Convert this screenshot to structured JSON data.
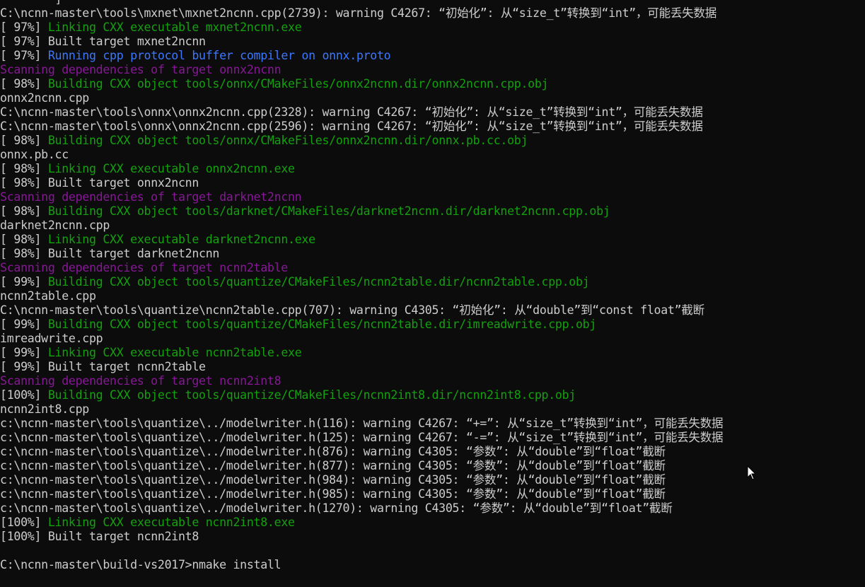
{
  "colors": {
    "background": "#0c0c0c",
    "default": "#cccccc",
    "green": "#13a10e",
    "blue": "#3b78ff",
    "magenta": "#881798"
  },
  "lines": [
    {
      "prefix": "",
      "text": "        ]",
      "color": "default"
    },
    {
      "prefix": "",
      "text": "C:\\ncnn-master\\tools\\mxnet\\mxnet2ncnn.cpp(2739): warning C4267: “初始化”: 从“size_t”转换到“int”，可能丢失数据",
      "color": "default"
    },
    {
      "prefix": "[ 97%] ",
      "text": "Linking CXX executable mxnet2ncnn.exe",
      "color": "green"
    },
    {
      "prefix": "[ 97%] ",
      "text": "Built target mxnet2ncnn",
      "color": "default"
    },
    {
      "prefix": "[ 97%] ",
      "text": "Running cpp protocol buffer compiler on onnx.proto",
      "color": "blue"
    },
    {
      "prefix": "",
      "text": "Scanning dependencies of target onnx2ncnn",
      "color": "magenta"
    },
    {
      "prefix": "[ 98%] ",
      "text": "Building CXX object tools/onnx/CMakeFiles/onnx2ncnn.dir/onnx2ncnn.cpp.obj",
      "color": "green"
    },
    {
      "prefix": "",
      "text": "onnx2ncnn.cpp",
      "color": "default"
    },
    {
      "prefix": "",
      "text": "C:\\ncnn-master\\tools\\onnx\\onnx2ncnn.cpp(2328): warning C4267: “初始化”: 从“size_t”转换到“int”，可能丢失数据",
      "color": "default"
    },
    {
      "prefix": "",
      "text": "C:\\ncnn-master\\tools\\onnx\\onnx2ncnn.cpp(2596): warning C4267: “初始化”: 从“size_t”转换到“int”，可能丢失数据",
      "color": "default"
    },
    {
      "prefix": "[ 98%] ",
      "text": "Building CXX object tools/onnx/CMakeFiles/onnx2ncnn.dir/onnx.pb.cc.obj",
      "color": "green"
    },
    {
      "prefix": "",
      "text": "onnx.pb.cc",
      "color": "default"
    },
    {
      "prefix": "[ 98%] ",
      "text": "Linking CXX executable onnx2ncnn.exe",
      "color": "green"
    },
    {
      "prefix": "[ 98%] ",
      "text": "Built target onnx2ncnn",
      "color": "default"
    },
    {
      "prefix": "",
      "text": "Scanning dependencies of target darknet2ncnn",
      "color": "magenta"
    },
    {
      "prefix": "[ 98%] ",
      "text": "Building CXX object tools/darknet/CMakeFiles/darknet2ncnn.dir/darknet2ncnn.cpp.obj",
      "color": "green"
    },
    {
      "prefix": "",
      "text": "darknet2ncnn.cpp",
      "color": "default"
    },
    {
      "prefix": "[ 98%] ",
      "text": "Linking CXX executable darknet2ncnn.exe",
      "color": "green"
    },
    {
      "prefix": "[ 98%] ",
      "text": "Built target darknet2ncnn",
      "color": "default"
    },
    {
      "prefix": "",
      "text": "Scanning dependencies of target ncnn2table",
      "color": "magenta"
    },
    {
      "prefix": "[ 99%] ",
      "text": "Building CXX object tools/quantize/CMakeFiles/ncnn2table.dir/ncnn2table.cpp.obj",
      "color": "green"
    },
    {
      "prefix": "",
      "text": "ncnn2table.cpp",
      "color": "default"
    },
    {
      "prefix": "",
      "text": "C:\\ncnn-master\\tools\\quantize\\ncnn2table.cpp(707): warning C4305: “初始化”: 从“double”到“const float”截断",
      "color": "default"
    },
    {
      "prefix": "[ 99%] ",
      "text": "Building CXX object tools/quantize/CMakeFiles/ncnn2table.dir/imreadwrite.cpp.obj",
      "color": "green"
    },
    {
      "prefix": "",
      "text": "imreadwrite.cpp",
      "color": "default"
    },
    {
      "prefix": "[ 99%] ",
      "text": "Linking CXX executable ncnn2table.exe",
      "color": "green"
    },
    {
      "prefix": "[ 99%] ",
      "text": "Built target ncnn2table",
      "color": "default"
    },
    {
      "prefix": "",
      "text": "Scanning dependencies of target ncnn2int8",
      "color": "magenta"
    },
    {
      "prefix": "[100%] ",
      "text": "Building CXX object tools/quantize/CMakeFiles/ncnn2int8.dir/ncnn2int8.cpp.obj",
      "color": "green"
    },
    {
      "prefix": "",
      "text": "ncnn2int8.cpp",
      "color": "default"
    },
    {
      "prefix": "",
      "text": "c:\\ncnn-master\\tools\\quantize\\../modelwriter.h(116): warning C4267: “+=”: 从“size_t”转换到“int”，可能丢失数据",
      "color": "default"
    },
    {
      "prefix": "",
      "text": "c:\\ncnn-master\\tools\\quantize\\../modelwriter.h(125): warning C4267: “-=”: 从“size_t”转换到“int”，可能丢失数据",
      "color": "default"
    },
    {
      "prefix": "",
      "text": "c:\\ncnn-master\\tools\\quantize\\../modelwriter.h(876): warning C4305: “参数”: 从“double”到“float”截断",
      "color": "default"
    },
    {
      "prefix": "",
      "text": "c:\\ncnn-master\\tools\\quantize\\../modelwriter.h(877): warning C4305: “参数”: 从“double”到“float”截断",
      "color": "default"
    },
    {
      "prefix": "",
      "text": "c:\\ncnn-master\\tools\\quantize\\../modelwriter.h(984): warning C4305: “参数”: 从“double”到“float”截断",
      "color": "default"
    },
    {
      "prefix": "",
      "text": "c:\\ncnn-master\\tools\\quantize\\../modelwriter.h(985): warning C4305: “参数”: 从“double”到“float”截断",
      "color": "default"
    },
    {
      "prefix": "",
      "text": "c:\\ncnn-master\\tools\\quantize\\../modelwriter.h(1270): warning C4305: “参数”: 从“double”到“float”截断",
      "color": "default"
    },
    {
      "prefix": "[100%] ",
      "text": "Linking CXX executable ncnn2int8.exe",
      "color": "green"
    },
    {
      "prefix": "[100%] ",
      "text": "Built target ncnn2int8",
      "color": "default"
    },
    {
      "prefix": "",
      "text": "",
      "color": "default"
    },
    {
      "prefix": "",
      "text": "C:\\ncnn-master\\build-vs2017>nmake install",
      "color": "default"
    }
  ],
  "cursor_icon": "mouse-pointer-icon"
}
